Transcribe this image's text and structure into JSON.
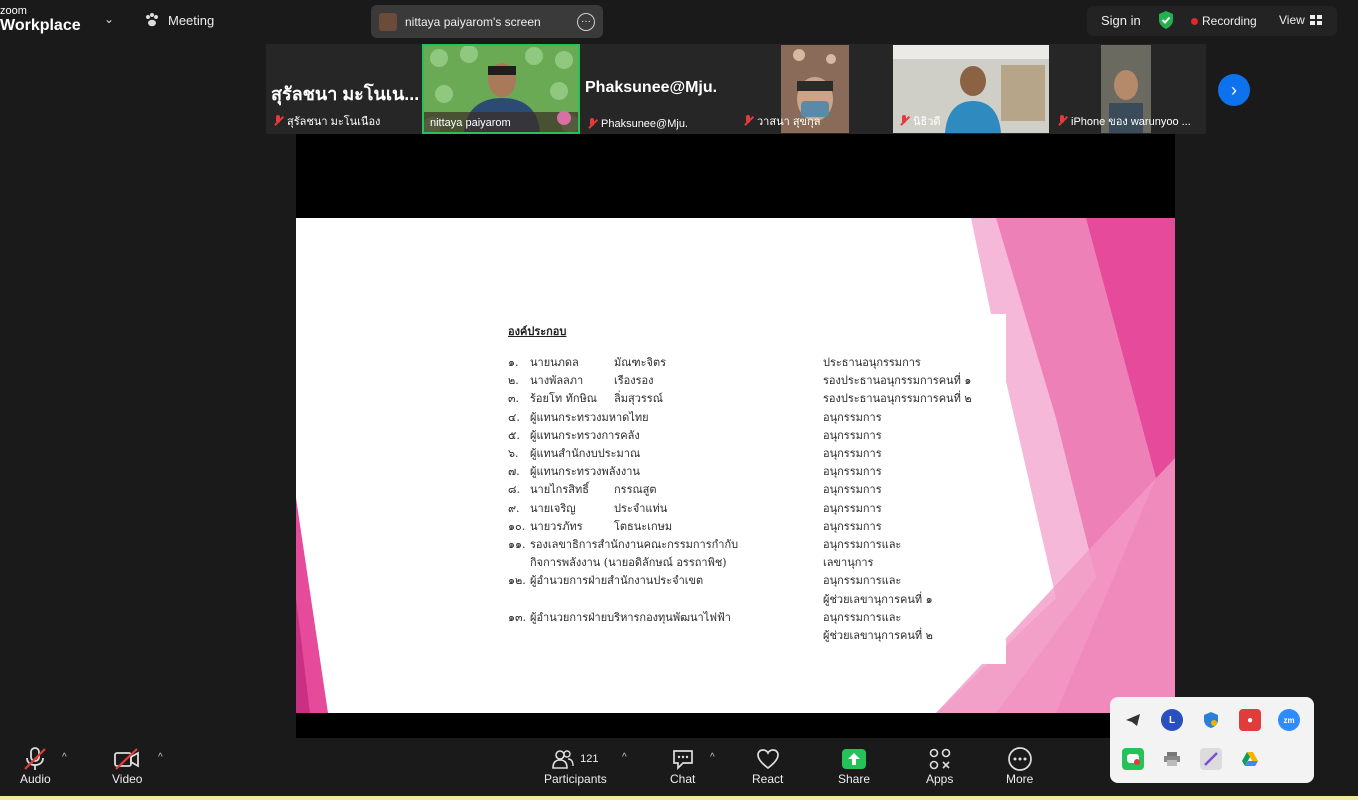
{
  "app": {
    "logo_top": "zoom",
    "logo_bottom": "Workplace",
    "meeting_label": "Meeting",
    "screen_share_label": "nittaya paiyarom's screen",
    "sign_in": "Sign in",
    "recording": "Recording",
    "view": "View"
  },
  "participants_strip": [
    {
      "name": "สุรัลชนา มะโนเนือง",
      "big_label": "สุรัลชนา มะโนเน...",
      "muted": true
    },
    {
      "name": "nittaya paiyarom",
      "muted": false,
      "active": true
    },
    {
      "name": "Phaksunee@Mju.",
      "big_label": "Phaksunee@Mju.",
      "muted": true
    },
    {
      "name": "วาสนา สุขกุล",
      "muted": true
    },
    {
      "name": "นิธิวดี",
      "muted": true
    },
    {
      "name": "iPhone ของ warunyoo ...",
      "muted": true
    }
  ],
  "slide": {
    "heading": "องค์ประกอบ",
    "rows": [
      {
        "num": "๑.",
        "name": "นายนภดล",
        "surname": "มัณฑะจิตร",
        "role": "ประธานอนุกรรมการ"
      },
      {
        "num": "๒.",
        "name": "นางพัลลภา",
        "surname": "เรืองรอง",
        "role": "รองประธานอนุกรรมการคนที่ ๑"
      },
      {
        "num": "๓.",
        "name": "ร้อยโท ทักษิณ",
        "surname": "ลิ่มสุวรรณ์",
        "role": "รองประธานอนุกรรมการคนที่ ๒"
      },
      {
        "num": "๔.",
        "name": "ผู้แทนกระทรวงมหาดไทย",
        "surname": "",
        "role": "อนุกรรมการ"
      },
      {
        "num": "๕.",
        "name": "ผู้แทนกระทรวงการคลัง",
        "surname": "",
        "role": "อนุกรรมการ"
      },
      {
        "num": "๖.",
        "name": "ผู้แทนสำนักงบประมาณ",
        "surname": "",
        "role": "อนุกรรมการ"
      },
      {
        "num": "๗.",
        "name": "ผู้แทนกระทรวงพลังงาน",
        "surname": "",
        "role": "อนุกรรมการ"
      },
      {
        "num": "๘.",
        "name": "นายไกรสิทธิ์",
        "surname": "กรรณสูต",
        "role": "อนุกรรมการ"
      },
      {
        "num": "๙.",
        "name": "นายเจริญ",
        "surname": "ประจำแท่น",
        "role": "อนุกรรมการ"
      },
      {
        "num": "๑๐.",
        "name": "นายวรภัทร",
        "surname": "โตธนะเกษม",
        "role": "อนุกรรมการ"
      },
      {
        "num": "๑๑.",
        "name": "รองเลขาธิการสำนักงานคณะกรรมการกำกับ",
        "surname": "",
        "role": "อนุกรรมการและ"
      },
      {
        "num": "",
        "name": "กิจการพลังงาน (นายอดิลักษณ์  อรรถาพิช)",
        "surname": "",
        "role": "เลขานุการ"
      },
      {
        "num": "๑๒.",
        "name": "ผู้อำนวยการฝ่ายสำนักงานประจำเขต",
        "surname": "",
        "role": "อนุกรรมการและ"
      },
      {
        "num": "",
        "name": "",
        "surname": "",
        "role": "ผู้ช่วยเลขานุการคนที่ ๑"
      },
      {
        "num": "๑๓.",
        "name": "ผู้อำนวยการฝ่ายบริหารกองทุนพัฒนาไฟฟ้า",
        "surname": "",
        "role": "อนุกรรมการและ"
      },
      {
        "num": "",
        "name": "",
        "surname": "",
        "role": "ผู้ช่วยเลขานุการคนที่ ๒"
      }
    ]
  },
  "toolbar": {
    "audio": "Audio",
    "video": "Video",
    "participants": "Participants",
    "participants_count": "121",
    "chat": "Chat",
    "react": "React",
    "share": "Share",
    "apps": "Apps",
    "more": "More"
  },
  "colors": {
    "accent_blue": "#0e72ed",
    "share_green": "#25c25a",
    "mute_red": "#e03c3c",
    "slide_pink": "#e64a9b"
  }
}
